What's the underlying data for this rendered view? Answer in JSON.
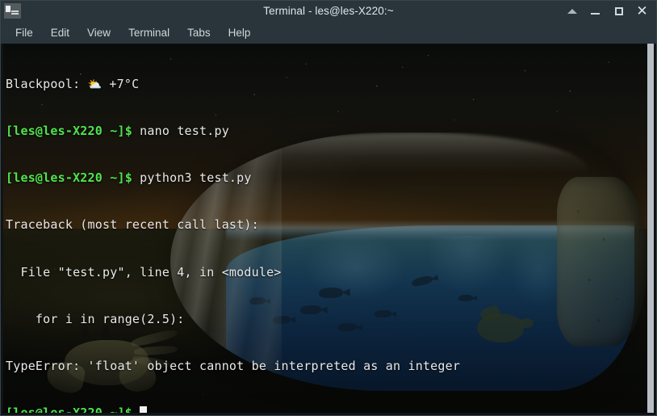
{
  "window": {
    "title": "Terminal - les@les-X220:~",
    "app_icon": "terminal-icon",
    "controls": {
      "shade": "▲",
      "minimize": "_",
      "maximize": "□",
      "close": "✕"
    }
  },
  "menubar": {
    "items": [
      {
        "label": "File"
      },
      {
        "label": "Edit"
      },
      {
        "label": "View"
      },
      {
        "label": "Terminal"
      },
      {
        "label": "Tabs"
      },
      {
        "label": "Help"
      }
    ]
  },
  "terminal": {
    "colors": {
      "prompt_green": "#4ee44e",
      "output_text": "#e8e8e8",
      "cursor": "#f2f2f2"
    },
    "weather": {
      "location": "Blackpool:",
      "icon": "⛅",
      "temperature": "+7°C"
    },
    "prompt_text": "[les@les-X220 ~]$",
    "lines": {
      "cmd1": " nano test.py",
      "cmd2": " python3 test.py",
      "tb1": "Traceback (most recent call last):",
      "tb2": "  File \"test.py\", line 4, in <module>",
      "tb3": "    for i in range(2.5):",
      "tb4": "TypeError: 'float' object cannot be interpreted as an integer"
    }
  },
  "wallpaper": {
    "description": "ship-in-a-bottle style glass bottle on a dark beach at night with an ocean, fish and a sea turtle inside, and a crab in the foreground"
  }
}
